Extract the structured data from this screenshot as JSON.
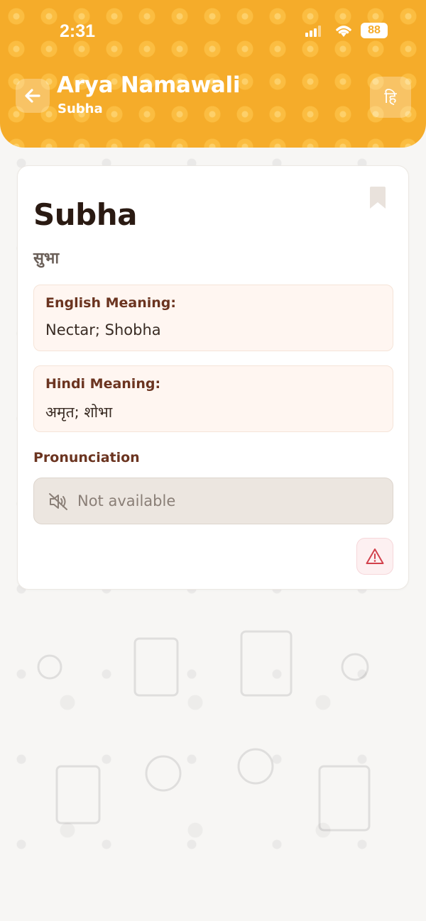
{
  "status_bar": {
    "time": "2:31",
    "battery": "88"
  },
  "header": {
    "title": "Arya Namawali",
    "subtitle": "Subha",
    "lang_toggle": "हि",
    "back_icon": "arrow-left-icon"
  },
  "name_card": {
    "name_english": "Subha",
    "name_hindi": "सुभा",
    "bookmark_icon": "bookmark-icon",
    "english_meaning": {
      "label": "English Meaning:",
      "value": "Nectar; Shobha"
    },
    "hindi_meaning": {
      "label": "Hindi Meaning:",
      "value": "अमृत; शोभा"
    },
    "pronunciation": {
      "label": "Pronunciation",
      "status": "Not available",
      "icon": "volume-off-icon"
    },
    "report_icon": "warning-triangle-icon"
  },
  "colors": {
    "header_bg": "#f5ac2a",
    "label_brown": "#6b3420",
    "meaning_bg": "#fff6f1",
    "report_red": "#d2414c"
  }
}
